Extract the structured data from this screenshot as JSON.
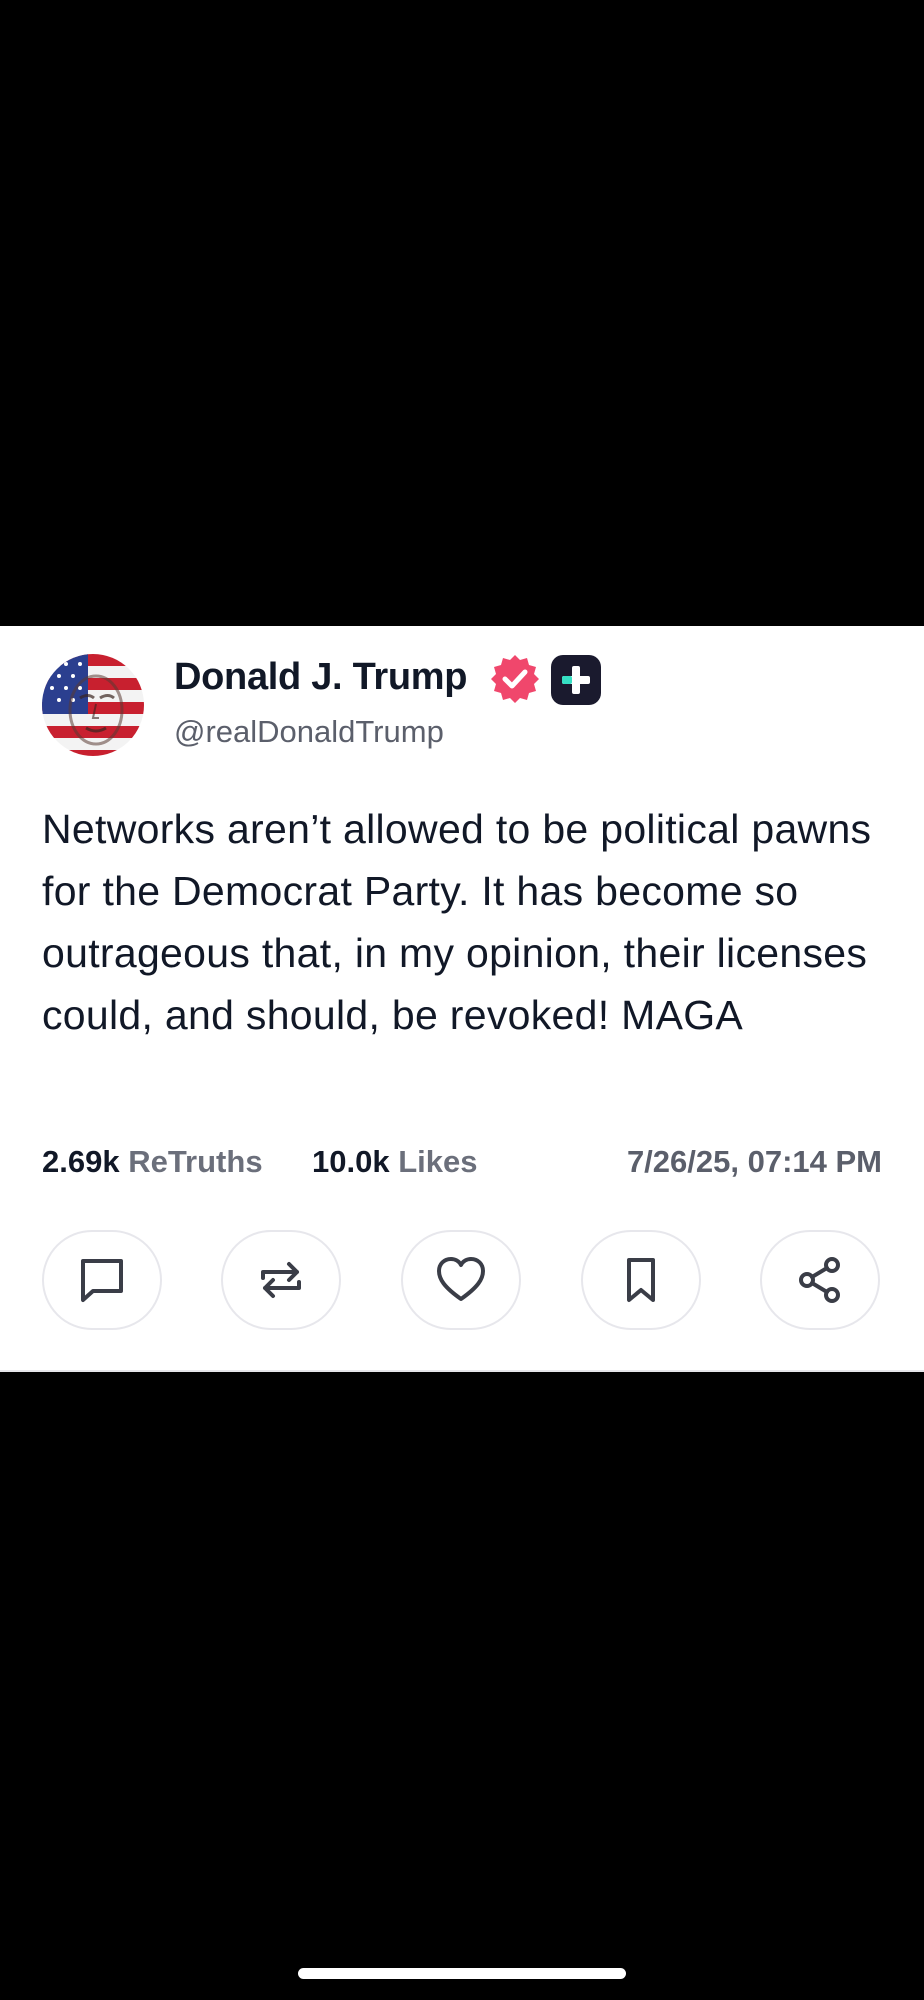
{
  "post": {
    "display_name": "Donald J. Trump",
    "handle": "@realDonaldTrump",
    "verified_badge_color": "#f0476c",
    "plus_badge_color": "#1a1a2e",
    "plus_badge_accent": "#35e0c4",
    "body": "Networks aren’t allowed to be political pawns for the Democrat Party. It has become so outrageous that, in my opinion, their licenses could, and should, be revoked! MAGA",
    "stats": {
      "retruths_count": "2.69k",
      "retruths_label": "ReTruths",
      "likes_count": "10.0k",
      "likes_label": "Likes"
    },
    "timestamp": "7/26/25, 07:14 PM"
  },
  "actions": [
    {
      "icon": "reply-icon"
    },
    {
      "icon": "retruth-icon"
    },
    {
      "icon": "heart-icon"
    },
    {
      "icon": "bookmark-icon"
    },
    {
      "icon": "share-icon"
    }
  ]
}
